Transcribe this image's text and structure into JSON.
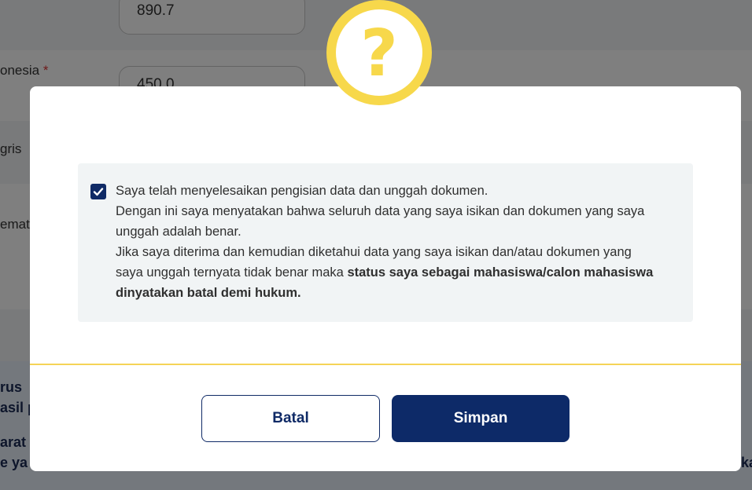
{
  "background": {
    "field_top_value": "890.7",
    "field_second_value": "450.0",
    "labels": [
      "onesia",
      "gris",
      "emat"
    ],
    "required_mark": "*",
    "notes": [
      "rus",
      "asil p",
      "arat",
      "e ya"
    ],
    "right_fragment": "ka"
  },
  "modal": {
    "icon": "question-icon",
    "icon_glyph": "?",
    "checkbox_checked": true,
    "statement": {
      "line1": "Saya telah menyelesaikan pengisian data dan unggah dokumen.",
      "line2": "Dengan ini saya menyatakan bahwa seluruh data yang saya isikan dan dokumen yang saya unggah adalah benar.",
      "line3": "Jika saya diterima dan kemudian diketahui data yang saya isikan dan/atau dokumen yang saya unggah ternyata tidak benar maka ",
      "line3_bold": "status saya sebagai mahasiswa/calon mahasiswa dinyatakan batal demi hukum."
    },
    "cancel_label": "Batal",
    "save_label": "Simpan"
  },
  "colors": {
    "accent_yellow": "#f7d84b",
    "primary_navy": "#0d2a68"
  }
}
